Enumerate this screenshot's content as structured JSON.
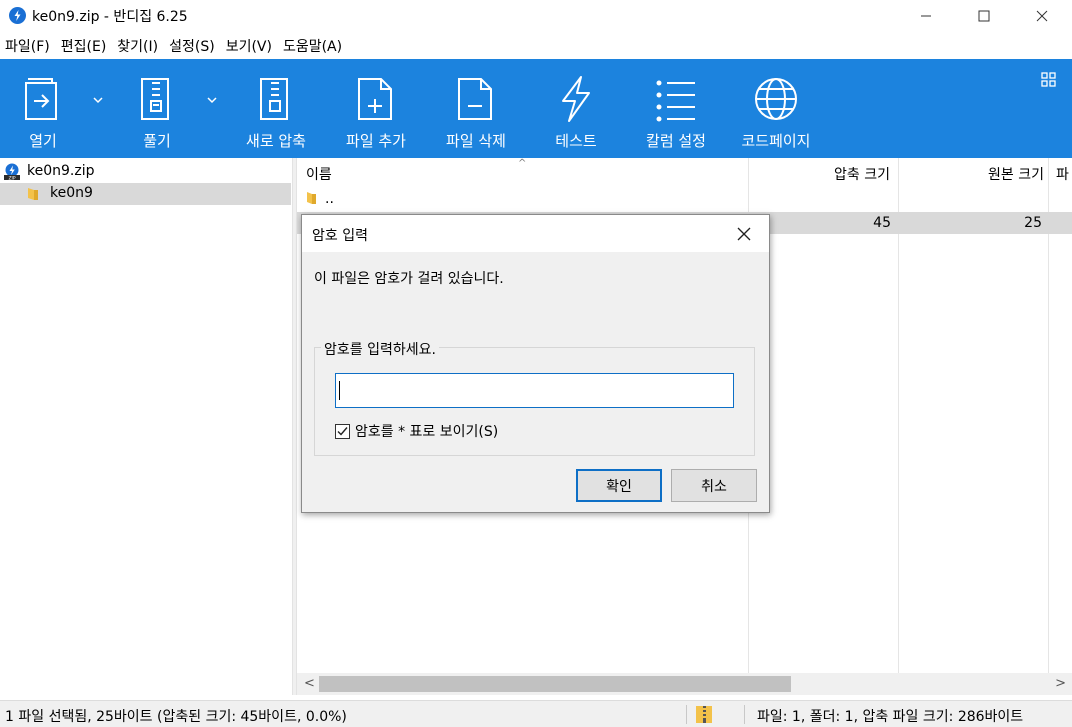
{
  "window": {
    "title": "ke0n9.zip - 반디집 6.25"
  },
  "menu": {
    "items": [
      "파일(F)",
      "편집(E)",
      "찾기(I)",
      "설정(S)",
      "보기(V)",
      "도움말(A)"
    ]
  },
  "toolbar": {
    "color": "#1c83de",
    "buttons": [
      {
        "label": "열기",
        "icon": "open-icon",
        "dropdown": true
      },
      {
        "label": "풀기",
        "icon": "extract-icon",
        "dropdown": true
      },
      {
        "label": "새로 압축",
        "icon": "new-archive-icon"
      },
      {
        "label": "파일 추가",
        "icon": "add-file-icon"
      },
      {
        "label": "파일 삭제",
        "icon": "delete-file-icon"
      },
      {
        "label": "테스트",
        "icon": "test-icon"
      },
      {
        "label": "칼럼 설정",
        "icon": "column-settings-icon"
      },
      {
        "label": "코드페이지",
        "icon": "codepage-icon"
      }
    ]
  },
  "tree": {
    "root": "ke0n9.zip",
    "child": "ke0n9"
  },
  "filelist": {
    "columns": {
      "name": "이름",
      "compressed": "압축 크기",
      "original": "원본 크기",
      "more": "파"
    },
    "parent_row": "..",
    "file_row": {
      "compressed": "45",
      "original": "25"
    }
  },
  "statusbar": {
    "left": "1 파일 선택됨, 25바이트 (압축된 크기: 45바이트, 0.0%)",
    "right": "파일: 1, 폴더: 1, 압축 파일 크기: 286바이트"
  },
  "dialog": {
    "title": "암호 입력",
    "message": "이 파일은 암호가 걸려 있습니다.",
    "group_label": "암호를 입력하세요.",
    "password_value": "",
    "show_password_label": "암호를 * 표로 보이기(S)",
    "show_password_checked": true,
    "ok_label": "확인",
    "cancel_label": "취소"
  }
}
